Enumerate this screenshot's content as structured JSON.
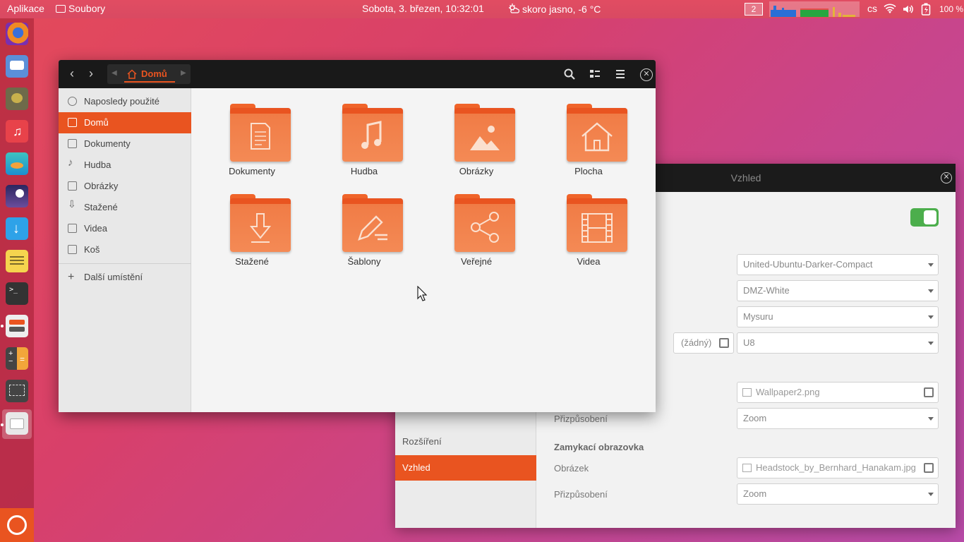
{
  "topbar": {
    "apps_label": "Aplikace",
    "files_label": "Soubory",
    "datetime": "Sobota,  3. březen, 10:32:01",
    "weather": "skoro jasno, -6 °C",
    "workspace": "2",
    "keyboard_layout": "cs",
    "battery": "100 %"
  },
  "launcher": {
    "items": [
      "firefox-icon",
      "messaging-icon",
      "gimp-icon",
      "music-icon",
      "photos-icon",
      "night-sky-icon",
      "downloader-icon",
      "notes-icon",
      "terminal-icon",
      "settings-tweak-icon",
      "calculator-icon",
      "screenshot-icon",
      "files-icon"
    ],
    "ubuntu_button": "ubuntu-logo-icon"
  },
  "files": {
    "breadcrumb": "Domů",
    "sidebar": [
      {
        "label": "Naposledy použité",
        "icon": "clock-icon"
      },
      {
        "label": "Domů",
        "icon": "home-icon"
      },
      {
        "label": "Dokumenty",
        "icon": "document-icon"
      },
      {
        "label": "Hudba",
        "icon": "music-note-icon"
      },
      {
        "label": "Obrázky",
        "icon": "picture-icon"
      },
      {
        "label": "Stažené",
        "icon": "download-icon"
      },
      {
        "label": "Videa",
        "icon": "film-icon"
      },
      {
        "label": "Koš",
        "icon": "trash-icon"
      }
    ],
    "other_locations": "Další umístění",
    "folders": [
      {
        "name": "Dokumenty",
        "emblem": "document-emblem-icon"
      },
      {
        "name": "Hudba",
        "emblem": "music-emblem-icon"
      },
      {
        "name": "Obrázky",
        "emblem": "picture-emblem-icon"
      },
      {
        "name": "Plocha",
        "emblem": "desktop-home-emblem-icon"
      },
      {
        "name": "Stažené",
        "emblem": "download-emblem-icon"
      },
      {
        "name": "Šablony",
        "emblem": "template-emblem-icon"
      },
      {
        "name": "Veřejné",
        "emblem": "share-emblem-icon"
      },
      {
        "name": "Videa",
        "emblem": "film-emblem-icon"
      }
    ]
  },
  "settings": {
    "title": "Vzhled",
    "sidebar": [
      "Rozšíření",
      "Vzhled"
    ],
    "gtk_theme": "United-Ubuntu-Darker-Compact",
    "cursor_theme": "DMZ-White",
    "icon_theme": "Mysuru",
    "shell_theme_button": "(žádný)",
    "shell_theme": "U8",
    "wallpaper_file": "Wallpaper2.png",
    "wallpaper_adjust_label": "Přizpůsobení",
    "wallpaper_adjust": "Zoom",
    "lock_screen_heading": "Zamykací obrazovka",
    "lock_image_label": "Obrázek",
    "lock_image_file": "Headstock_by_Bernhard_Hanakam.jpg",
    "lock_adjust_label": "Přizpůsobení",
    "lock_adjust": "Zoom"
  },
  "colors": {
    "accent": "#e95420",
    "toggle_on": "#4cae4c"
  }
}
